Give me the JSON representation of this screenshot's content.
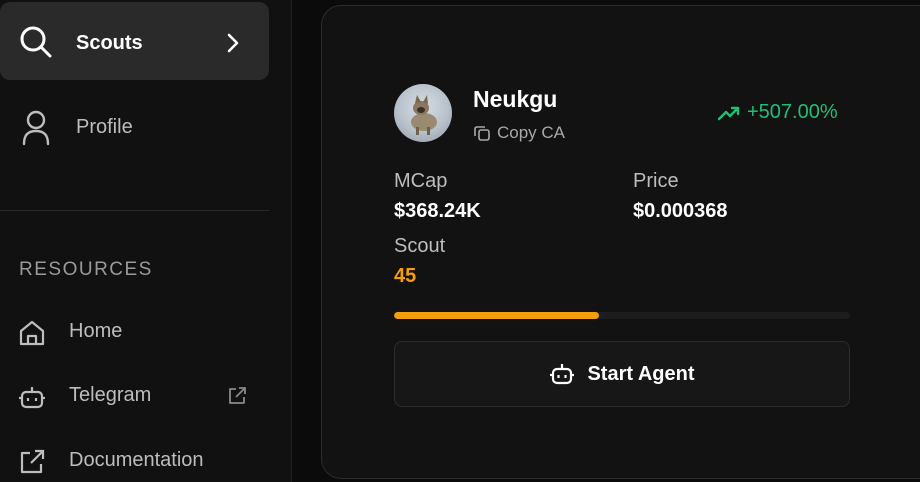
{
  "sidebar": {
    "nav": [
      {
        "label": "Scouts",
        "icon": "search-icon",
        "active": true
      },
      {
        "label": "Profile",
        "icon": "user-icon",
        "active": false
      }
    ],
    "resources_title": "RESOURCES",
    "resources": [
      {
        "label": "Home",
        "icon": "home-icon"
      },
      {
        "label": "Telegram",
        "icon": "bot-icon",
        "external": true
      },
      {
        "label": "Documentation",
        "icon": "external-link-icon"
      }
    ]
  },
  "token": {
    "name": "Neukgu",
    "copy_label": "Copy CA",
    "change": "+507.00%",
    "mcap_label": "MCap",
    "mcap_value": "$368.24K",
    "price_label": "Price",
    "price_value": "$0.000368",
    "scout_label": "Scout",
    "scout_value": "45",
    "progress": 0.45,
    "start_label": "Start Agent"
  },
  "colors": {
    "accent": "#f59e0b",
    "positive": "#1fbf75",
    "background": "#0b0b0b",
    "card": "#121212"
  }
}
